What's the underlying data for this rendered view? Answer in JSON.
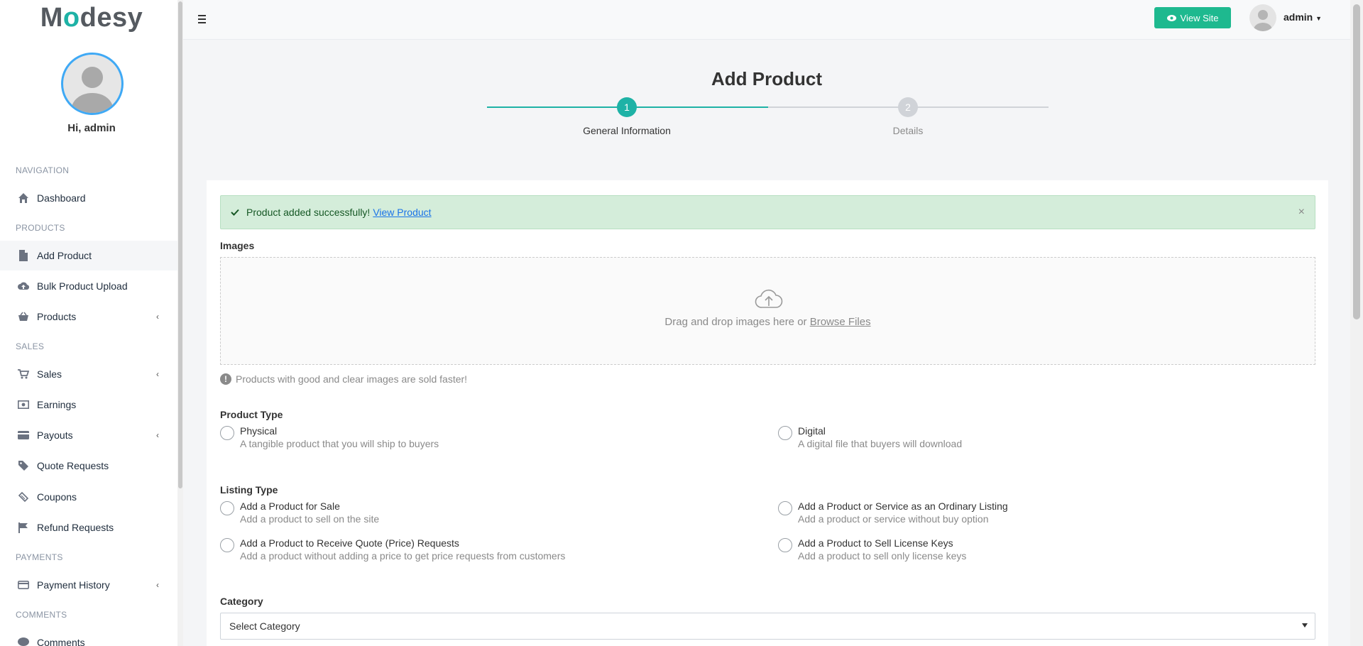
{
  "colors": {
    "accent": "#1eb98f",
    "step_active": "#1eb2a6",
    "step_inactive": "#d0d3d8",
    "alert_bg": "#d4edda"
  },
  "sidebar": {
    "logo_prefix": "M",
    "logo_o": "o",
    "logo_suffix": "desy",
    "greeting": "Hi, admin",
    "sections": {
      "navigation": "NAVIGATION",
      "products": "PRODUCTS",
      "sales": "SALES",
      "payments": "PAYMENTS",
      "comments": "COMMENTS"
    },
    "items": [
      {
        "label": "Dashboard",
        "icon": "home-icon"
      },
      {
        "label": "Add Product",
        "icon": "file-icon"
      },
      {
        "label": "Bulk Product Upload",
        "icon": "cloud-upload-icon"
      },
      {
        "label": "Products",
        "icon": "basket-icon"
      },
      {
        "label": "Sales",
        "icon": "cart-icon"
      },
      {
        "label": "Earnings",
        "icon": "money-icon"
      },
      {
        "label": "Payouts",
        "icon": "credit-card-icon"
      },
      {
        "label": "Quote Requests",
        "icon": "tag-icon"
      },
      {
        "label": "Coupons",
        "icon": "ticket-icon"
      },
      {
        "label": "Refund Requests",
        "icon": "flag-icon"
      },
      {
        "label": "Payment History",
        "icon": "credit-card-icon"
      },
      {
        "label": "Comments",
        "icon": "comment-icon"
      }
    ]
  },
  "topbar": {
    "view_site": "View Site",
    "user": "admin"
  },
  "wizard": {
    "title": "Add Product",
    "steps": [
      {
        "number": "1",
        "label": "General Information"
      },
      {
        "number": "2",
        "label": "Details"
      }
    ]
  },
  "form": {
    "alert_text": "Product added successfully!",
    "alert_link": "View Product",
    "alert_close": "×",
    "images_label": "Images",
    "dropzone_text": "Drag and drop images here or",
    "dropzone_link": "Browse Files",
    "images_hint": "Products with good and clear images are sold faster!",
    "product_type_label": "Product Type",
    "product_types": [
      {
        "title": "Physical",
        "desc": "A tangible product that you will ship to buyers"
      },
      {
        "title": "Digital",
        "desc": "A digital file that buyers will download"
      }
    ],
    "listing_type_label": "Listing Type",
    "listing_types": [
      {
        "title": "Add a Product for Sale",
        "desc": "Add a product to sell on the site"
      },
      {
        "title": "Add a Product or Service as an Ordinary Listing",
        "desc": "Add a product or service without buy option"
      },
      {
        "title": "Add a Product to Receive Quote (Price) Requests",
        "desc": "Add a product without adding a price to get price requests from customers"
      },
      {
        "title": "Add a Product to Sell License Keys",
        "desc": "Add a product to sell only license keys"
      }
    ],
    "category_label": "Category",
    "category_select": "Select Category"
  }
}
